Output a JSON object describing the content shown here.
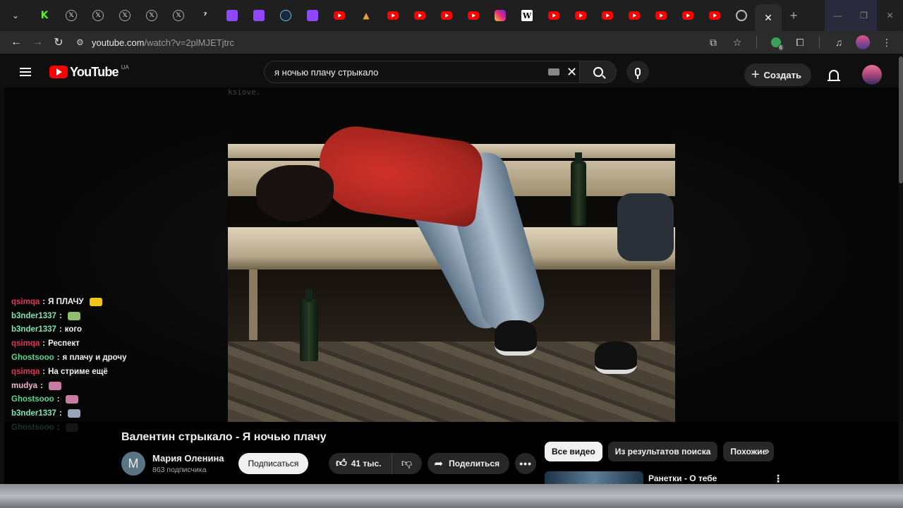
{
  "browser": {
    "tabs": [
      {
        "icon": "kick-icon",
        "letter": "K"
      },
      {
        "icon": "x-icon",
        "letter": "𝕏"
      },
      {
        "icon": "x-icon",
        "letter": "𝕏"
      },
      {
        "icon": "x-icon",
        "letter": "𝕏"
      },
      {
        "icon": "x-icon",
        "letter": "𝕏"
      },
      {
        "icon": "x-icon",
        "letter": "𝕏"
      },
      {
        "icon": "dark-icon",
        "letter": "⁷"
      },
      {
        "icon": "twitch-icon",
        "letter": ""
      },
      {
        "icon": "twitch-icon",
        "letter": ""
      },
      {
        "icon": "steam-icon",
        "letter": ""
      },
      {
        "icon": "twitch-icon",
        "letter": ""
      },
      {
        "icon": "youtube-icon",
        "letter": ""
      },
      {
        "icon": "cone-icon",
        "letter": "▲"
      },
      {
        "icon": "youtube-icon",
        "letter": ""
      },
      {
        "icon": "youtube-icon",
        "letter": ""
      },
      {
        "icon": "youtube-icon",
        "letter": ""
      },
      {
        "icon": "youtube-icon",
        "letter": ""
      },
      {
        "icon": "instagram-icon",
        "letter": ""
      },
      {
        "icon": "wikipedia-icon",
        "letter": "W"
      },
      {
        "icon": "youtube-icon",
        "letter": ""
      },
      {
        "icon": "youtube-icon",
        "letter": ""
      },
      {
        "icon": "youtube-icon",
        "letter": ""
      },
      {
        "icon": "youtube-icon",
        "letter": ""
      },
      {
        "icon": "youtube-icon",
        "letter": ""
      },
      {
        "icon": "youtube-icon",
        "letter": ""
      },
      {
        "icon": "youtube-icon",
        "letter": ""
      },
      {
        "icon": "globe-icon",
        "letter": ""
      }
    ],
    "active_tab_close": "✕",
    "new_tab": "+",
    "url_host": "youtube.com",
    "url_path": "/watch?v=2plMJETjtrc",
    "extension_badge": "6"
  },
  "youtube": {
    "logo_text": "YouTube",
    "country": "UA",
    "search_value": "я ночью плачу стрыкало",
    "create_label": "Создать"
  },
  "chat": [
    {
      "user": "qsimqa",
      "color": "#e0365a",
      "msg": "Я ПЛАЧУ",
      "emote": "#f0c419"
    },
    {
      "user": "b3nder1337",
      "color": "#7ee6b8",
      "msg": "",
      "emote": "#8fbf6a"
    },
    {
      "user": "b3nder1337",
      "color": "#7ee6b8",
      "msg": "кого",
      "emote": ""
    },
    {
      "user": "qsimqa",
      "color": "#e0365a",
      "msg": "Респект",
      "emote": ""
    },
    {
      "user": "Ghostsooo",
      "color": "#59d68f",
      "msg": "я плачу и дрочу",
      "emote": ""
    },
    {
      "user": "qsimqa",
      "color": "#e0365a",
      "msg": "На стриме ещё",
      "emote": ""
    },
    {
      "user": "mudya",
      "color": "#f2b6c8",
      "msg": "",
      "emote": "#c77ba0"
    },
    {
      "user": "Ghostsooo",
      "color": "#59d68f",
      "msg": "",
      "emote": "#c77ba0"
    },
    {
      "user": "b3nder1337",
      "color": "#7ee6b8",
      "msg": "",
      "emote": "#9aa6b8"
    },
    {
      "user": "Ghostsooo",
      "color": "#59d68f",
      "msg": "",
      "emote": "#555"
    }
  ],
  "video": {
    "watermark": "ksiove.",
    "title": "Валентин стрыкало - Я ночью плачу",
    "channel_name": "Мария Оленина",
    "channel_initial": "M",
    "subscribers": "863 подписчика",
    "subscribe_label": "Подписаться",
    "likes": "41 тыс.",
    "share_label": "Поделиться",
    "more_label": "•••"
  },
  "chips": [
    "Все видео",
    "Из результатов поиска",
    "Похожие"
  ],
  "recommendation": {
    "title": "Ранетки - О тебе"
  }
}
